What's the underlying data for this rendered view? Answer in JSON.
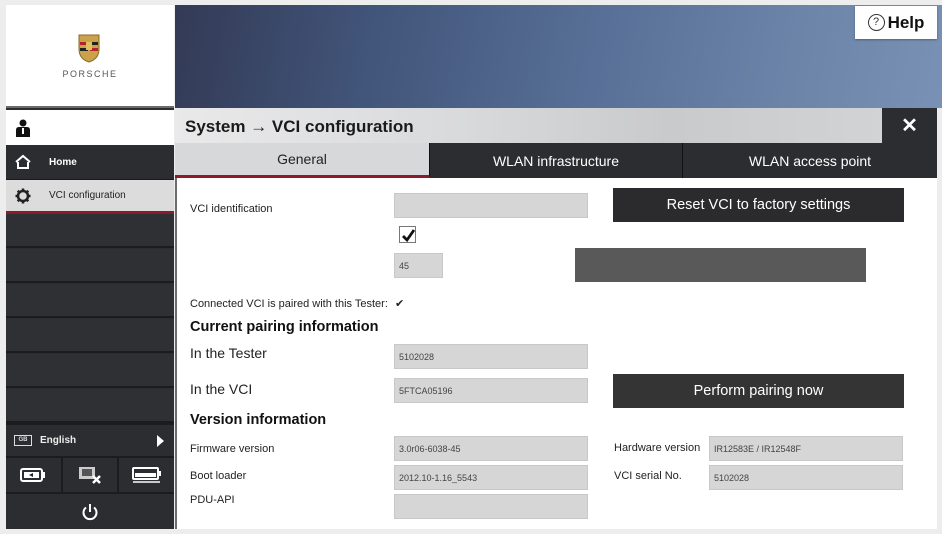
{
  "sidebar": {
    "brand": "PORSCHE",
    "items": [
      {
        "label": "Home",
        "icon": "home-icon"
      },
      {
        "label": "VCI configuration",
        "icon": "gear-icon"
      }
    ],
    "language": {
      "badge": "GB",
      "label": "English"
    },
    "status_icons": [
      "battery-charging-icon",
      "network-disconnected-icon",
      "battery-level-icon"
    ],
    "power_icon": "power-icon"
  },
  "header": {
    "help_label": "Help",
    "title": "System → VCI configuration",
    "close_icon": "close-icon"
  },
  "tabs": [
    {
      "label": "General",
      "active": true
    },
    {
      "label": "WLAN infrastructure",
      "active": false
    },
    {
      "label": "WLAN access point",
      "active": false
    }
  ],
  "general": {
    "vci_identification": {
      "label": "VCI identification",
      "value": ""
    },
    "checkbox_checked": true,
    "number_field": "45",
    "reset_button": "Reset VCI to factory settings",
    "paired_label": "Connected VCI is paired with this Tester:",
    "paired_status": "✔",
    "pairing": {
      "heading": "Current pairing information",
      "tester_label": "In the Tester",
      "tester_value": "5102028",
      "vci_label": "In the VCI",
      "vci_value": "5FTCA05196",
      "pair_button": "Perform pairing now"
    },
    "version": {
      "heading": "Version information",
      "firmware_label": "Firmware version",
      "firmware_value": "3.0r06-6038-45",
      "bootloader_label": "Boot loader",
      "bootloader_value": "2012.10-1.16_5543",
      "pdu_label": "PDU-API",
      "pdu_value": "",
      "hardware_label": "Hardware version",
      "hardware_value": "IR12583E / IR12548F",
      "serial_label": "VCI serial No.",
      "serial_value": "5102028"
    }
  },
  "colors": {
    "accent": "#8b1a2b",
    "dark": "#2c2d30",
    "field": "#d6d6d6"
  }
}
